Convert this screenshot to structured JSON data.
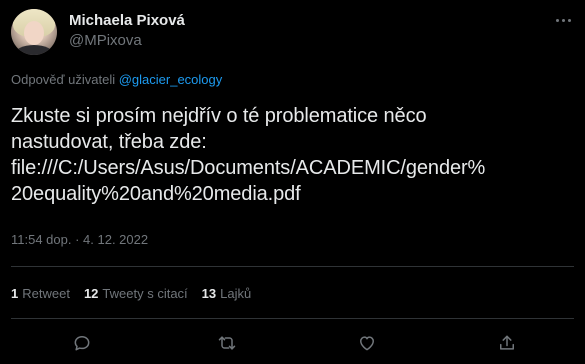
{
  "author": {
    "name": "Michaela Pixová",
    "handle": "@MPixova"
  },
  "reply": {
    "prefix": "Odpověď uživateli",
    "mention": "@glacier_ecology"
  },
  "tweet": {
    "lines": [
      "Zkuste si prosím nejdřív o té problematice něco",
      "nastudovat, třeba zde:",
      "file:///C:/Users/Asus/Documents/ACADEMIC/gender%",
      "20equality%20and%20media.pdf"
    ],
    "timestamp": "11:54 dop. · 4. 12. 2022"
  },
  "stats": [
    {
      "count": "1",
      "label": "Retweet"
    },
    {
      "count": "12",
      "label": "Tweety s citací"
    },
    {
      "count": "13",
      "label": "Lajků"
    }
  ],
  "icons": {
    "more": "more-dots-icon",
    "reply": "reply-icon",
    "retweet": "retweet-icon",
    "like": "like-icon",
    "share": "share-icon"
  },
  "colors": {
    "background": "#000000",
    "text": "#e7e9ea",
    "muted": "#71767b",
    "accent": "#1d9bf0",
    "divider": "#2f3336"
  }
}
